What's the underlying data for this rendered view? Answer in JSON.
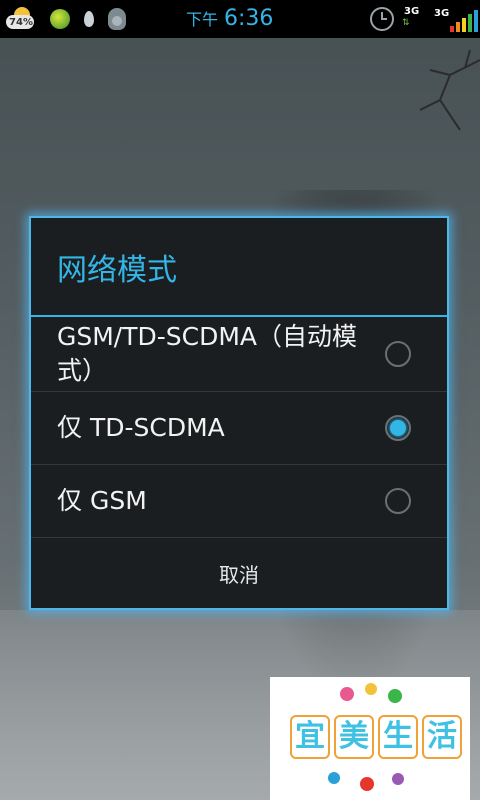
{
  "status_bar": {
    "weather_percent": "74%",
    "time_ampm": "下午",
    "time": "6:36",
    "network_badge_top": "3G",
    "network_badge_bottom": "⇅",
    "signal_label": "3G",
    "signal_colors": [
      "#e6372a",
      "#f08a24",
      "#f4d11c",
      "#39b54a",
      "#2a9fd8"
    ]
  },
  "dialog": {
    "title": "网络模式",
    "options": [
      {
        "label": "GSM/TD-SCDMA（自动模式）",
        "selected": false
      },
      {
        "label": "仅 TD-SCDMA",
        "selected": true
      },
      {
        "label": "仅 GSM",
        "selected": false
      }
    ],
    "cancel_label": "取消"
  },
  "watermark": {
    "chars": [
      "宜",
      "美",
      "生",
      "活"
    ]
  }
}
